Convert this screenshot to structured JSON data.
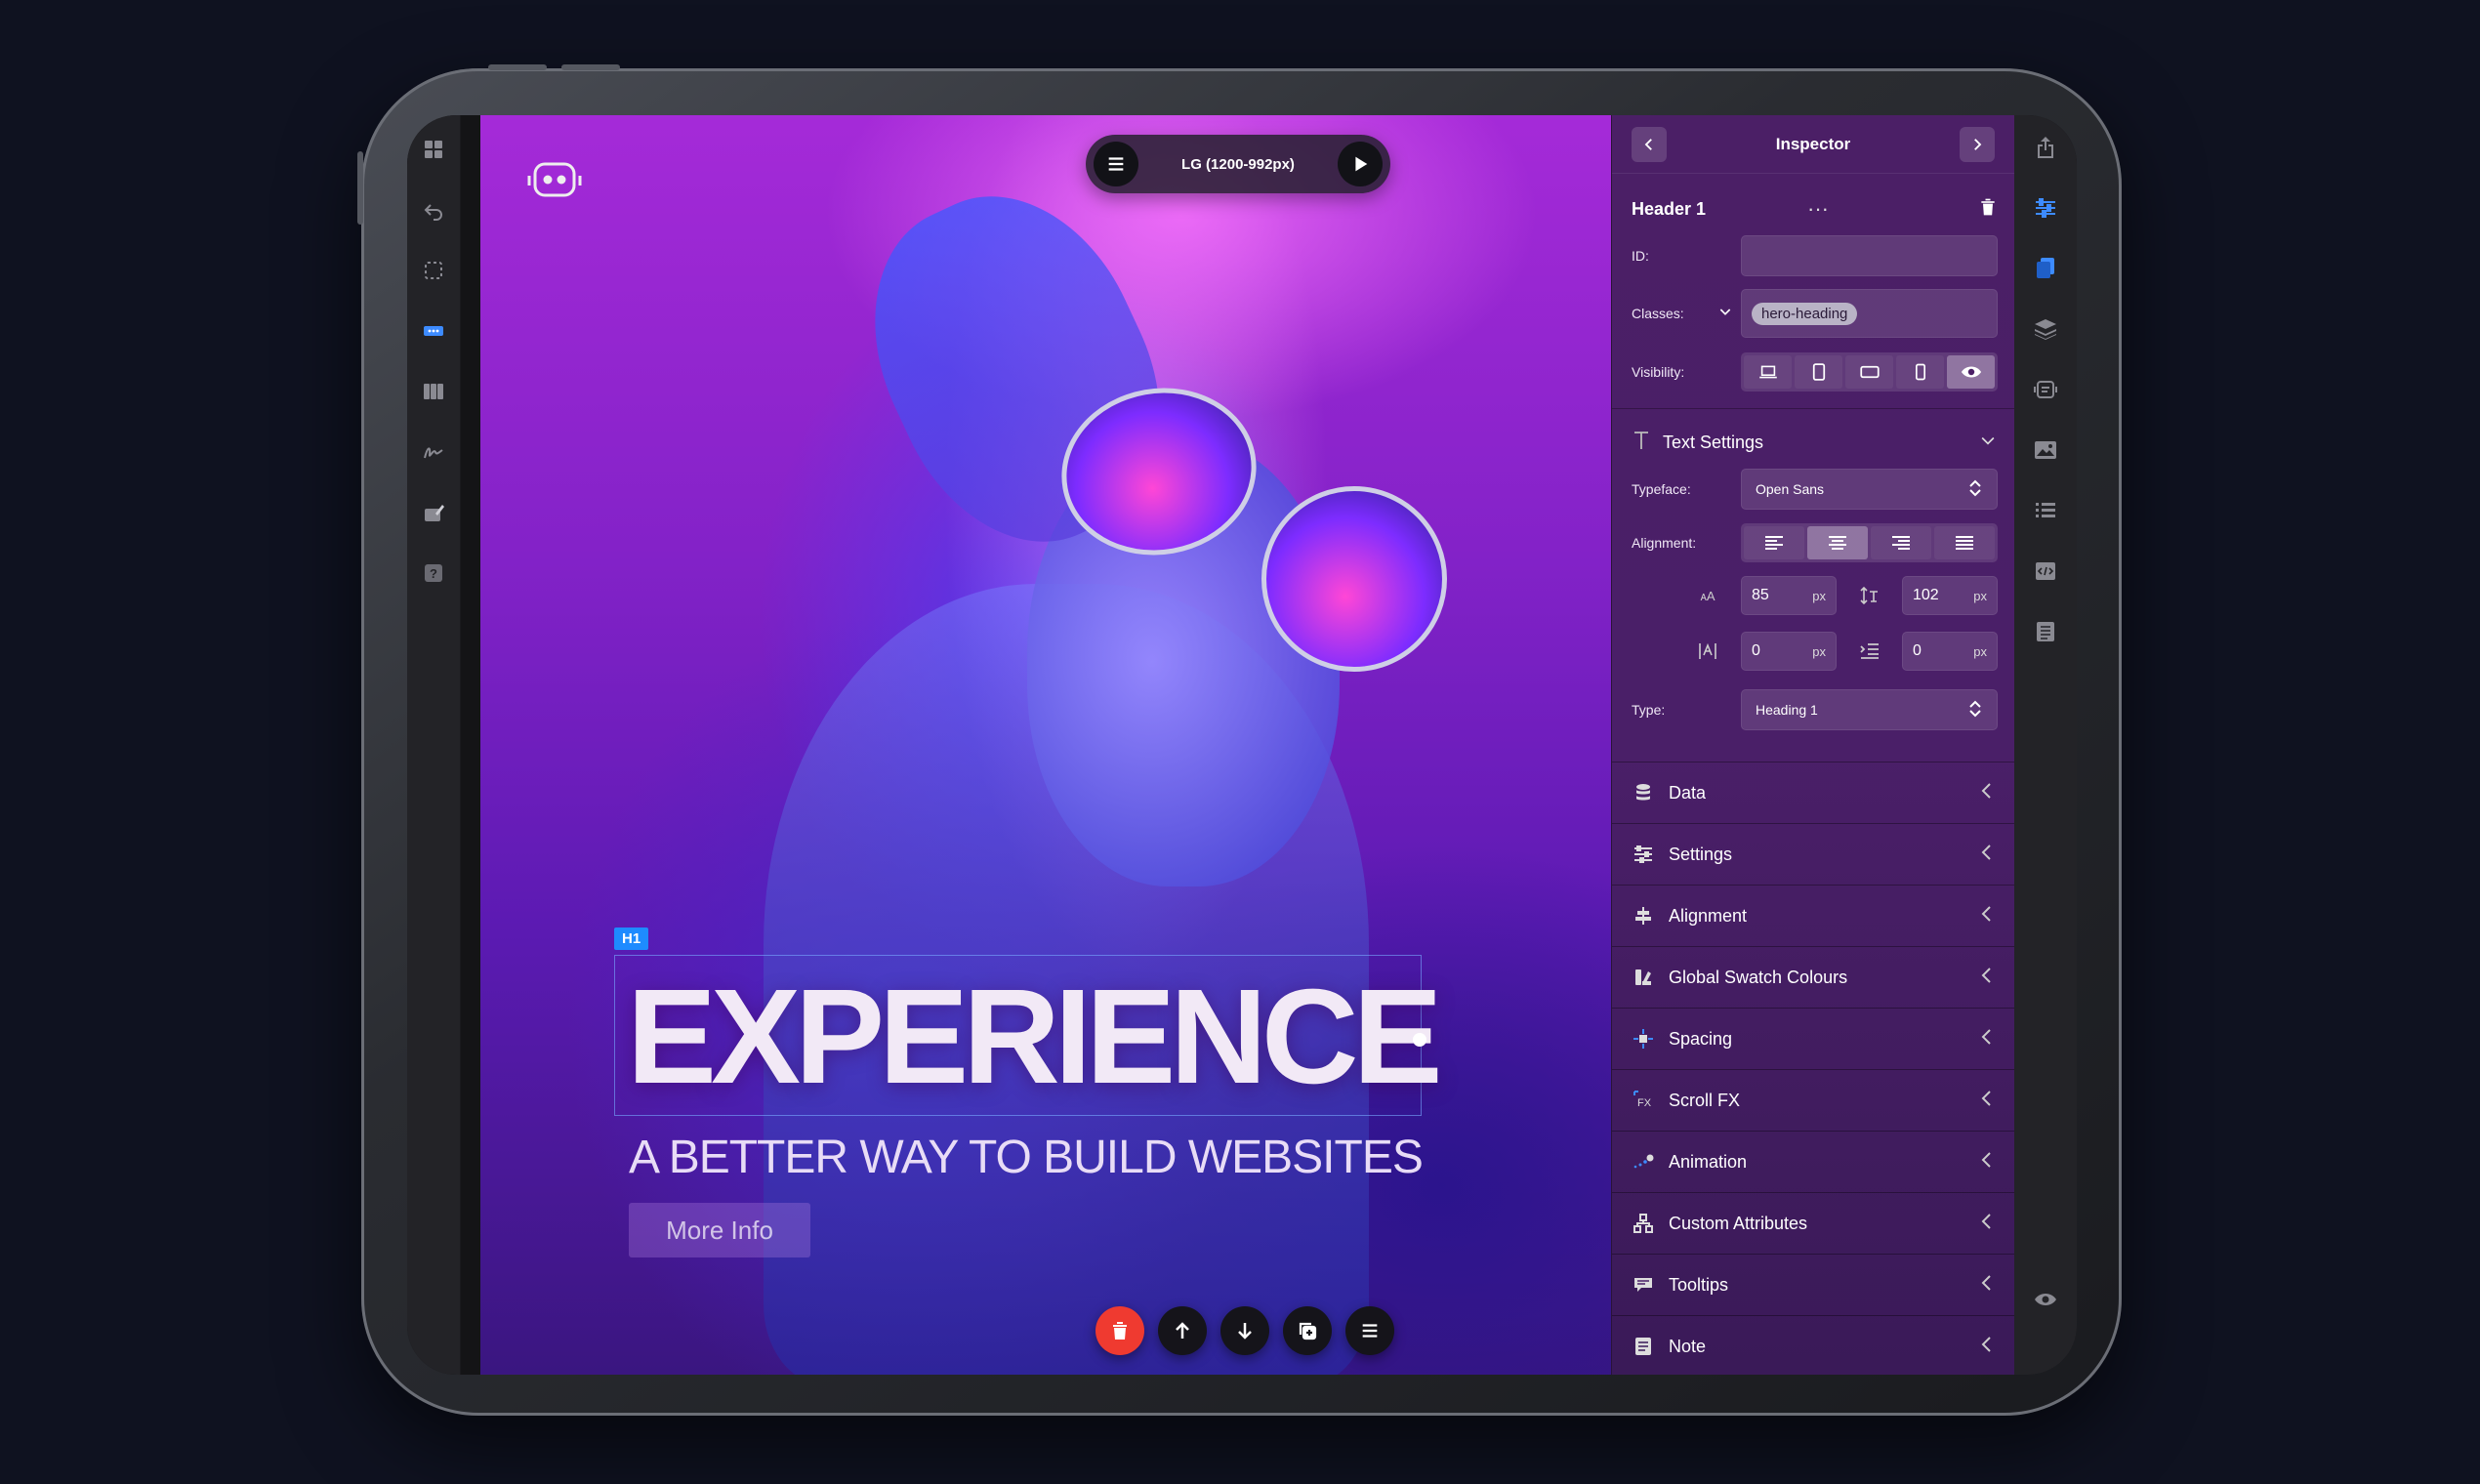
{
  "canvas": {
    "device_label": "LG (1200-992px)",
    "element_tag": "H1",
    "hero_title": "EXPERIENCE",
    "hero_subtitle": "A BETTER WAY TO BUILD WEBSITES",
    "button_label": "More Info"
  },
  "inspector": {
    "title": "Inspector",
    "element_name": "Header 1",
    "id_label": "ID:",
    "id_value": "",
    "classes_label": "Classes:",
    "class_chip": "hero-heading",
    "visibility_label": "Visibility:",
    "text_settings": {
      "title": "Text Settings",
      "typeface_label": "Typeface:",
      "typeface_value": "Open Sans",
      "alignment_label": "Alignment:",
      "font_size": "85",
      "line_height": "102",
      "letter_spacing": "0",
      "indent": "0",
      "unit": "px",
      "type_label": "Type:",
      "type_value": "Heading 1"
    },
    "sections": [
      {
        "label": "Data",
        "icon": "database-icon"
      },
      {
        "label": "Settings",
        "icon": "sliders-icon"
      },
      {
        "label": "Alignment",
        "icon": "align-icon"
      },
      {
        "label": "Global Swatch Colours",
        "icon": "swatch-icon"
      },
      {
        "label": "Spacing",
        "icon": "spacing-icon"
      },
      {
        "label": "Scroll FX",
        "icon": "scroll-fx-icon"
      },
      {
        "label": "Animation",
        "icon": "animation-icon"
      },
      {
        "label": "Custom Attributes",
        "icon": "attributes-icon"
      },
      {
        "label": "Tooltips",
        "icon": "tooltip-icon"
      },
      {
        "label": "Note",
        "icon": "note-icon"
      }
    ]
  },
  "colors": {
    "accent": "#3d8bff",
    "danger": "#ef3a30",
    "inspector_bg": "#4b1f66"
  }
}
